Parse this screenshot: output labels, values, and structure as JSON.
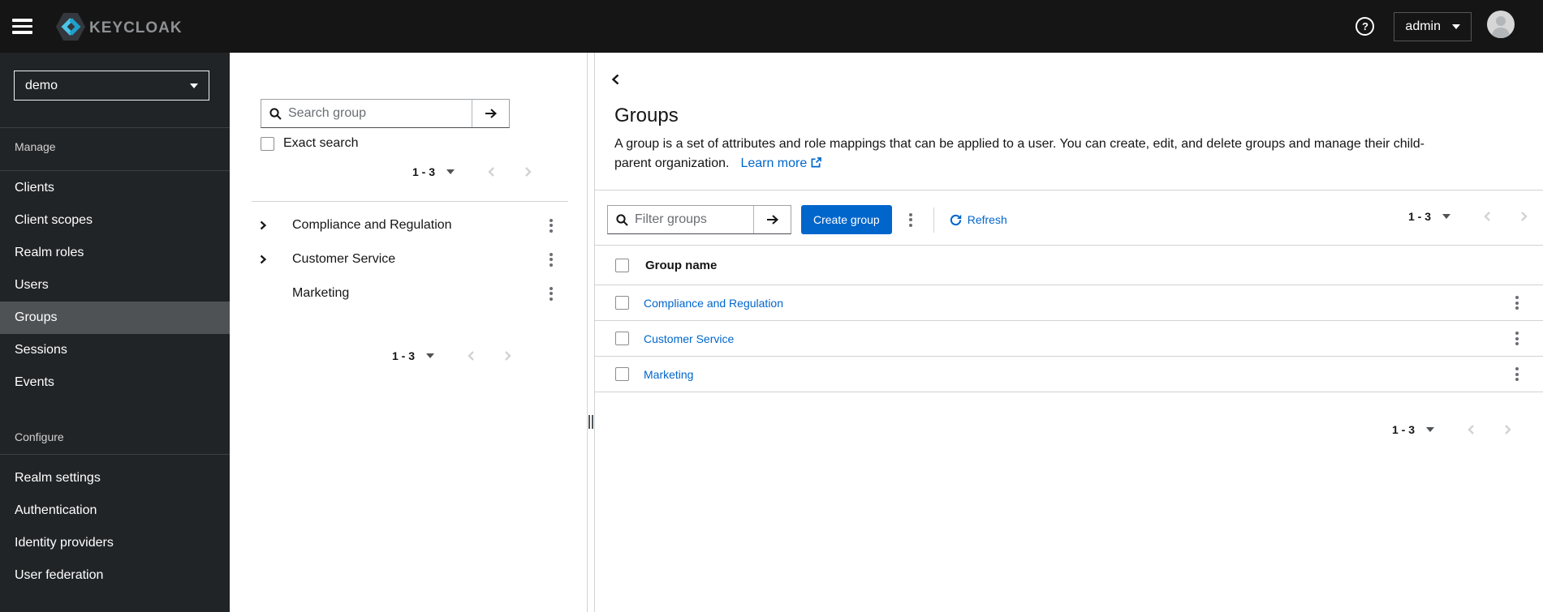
{
  "topbar": {
    "brand": "KEYCLOAK",
    "help_label": "?",
    "username": "admin"
  },
  "sidebar": {
    "realm": "demo",
    "active_item": "Groups",
    "sections": [
      {
        "label": "Manage",
        "items": [
          {
            "label": "Clients"
          },
          {
            "label": "Client scopes"
          },
          {
            "label": "Realm roles"
          },
          {
            "label": "Users"
          },
          {
            "label": "Groups"
          },
          {
            "label": "Sessions"
          },
          {
            "label": "Events"
          }
        ]
      },
      {
        "label": "Configure",
        "items": [
          {
            "label": "Realm settings"
          },
          {
            "label": "Authentication"
          },
          {
            "label": "Identity providers"
          },
          {
            "label": "User federation"
          }
        ]
      }
    ]
  },
  "tree_panel": {
    "search_placeholder": "Search group",
    "exact_search_label": "Exact search",
    "pagination_top": "1 - 3",
    "pagination_bottom": "1 - 3",
    "items": [
      {
        "label": "Compliance and Regulation",
        "expandable": true
      },
      {
        "label": "Customer Service",
        "expandable": true
      },
      {
        "label": "Marketing",
        "expandable": false
      }
    ]
  },
  "main": {
    "title": "Groups",
    "description": "A group is a set of attributes and role mappings that can be applied to a user. You can create, edit, and delete groups and manage their child-parent organization.",
    "learn_more_label": "Learn more",
    "toolbar": {
      "filter_placeholder": "Filter groups",
      "create_button_label": "Create group",
      "refresh_label": "Refresh",
      "pagination": "1 - 3"
    },
    "table": {
      "column_header": "Group name",
      "rows": [
        {
          "name": "Compliance and Regulation"
        },
        {
          "name": "Customer Service"
        },
        {
          "name": "Marketing"
        }
      ]
    },
    "pagination_bottom": "1 - 3"
  },
  "colors": {
    "accent_blue": "#0066cc",
    "topbar_bg": "#151515",
    "sidebar_bg": "#212427",
    "active_nav_bg": "#4f5255",
    "border_light": "#d2d2d2"
  }
}
